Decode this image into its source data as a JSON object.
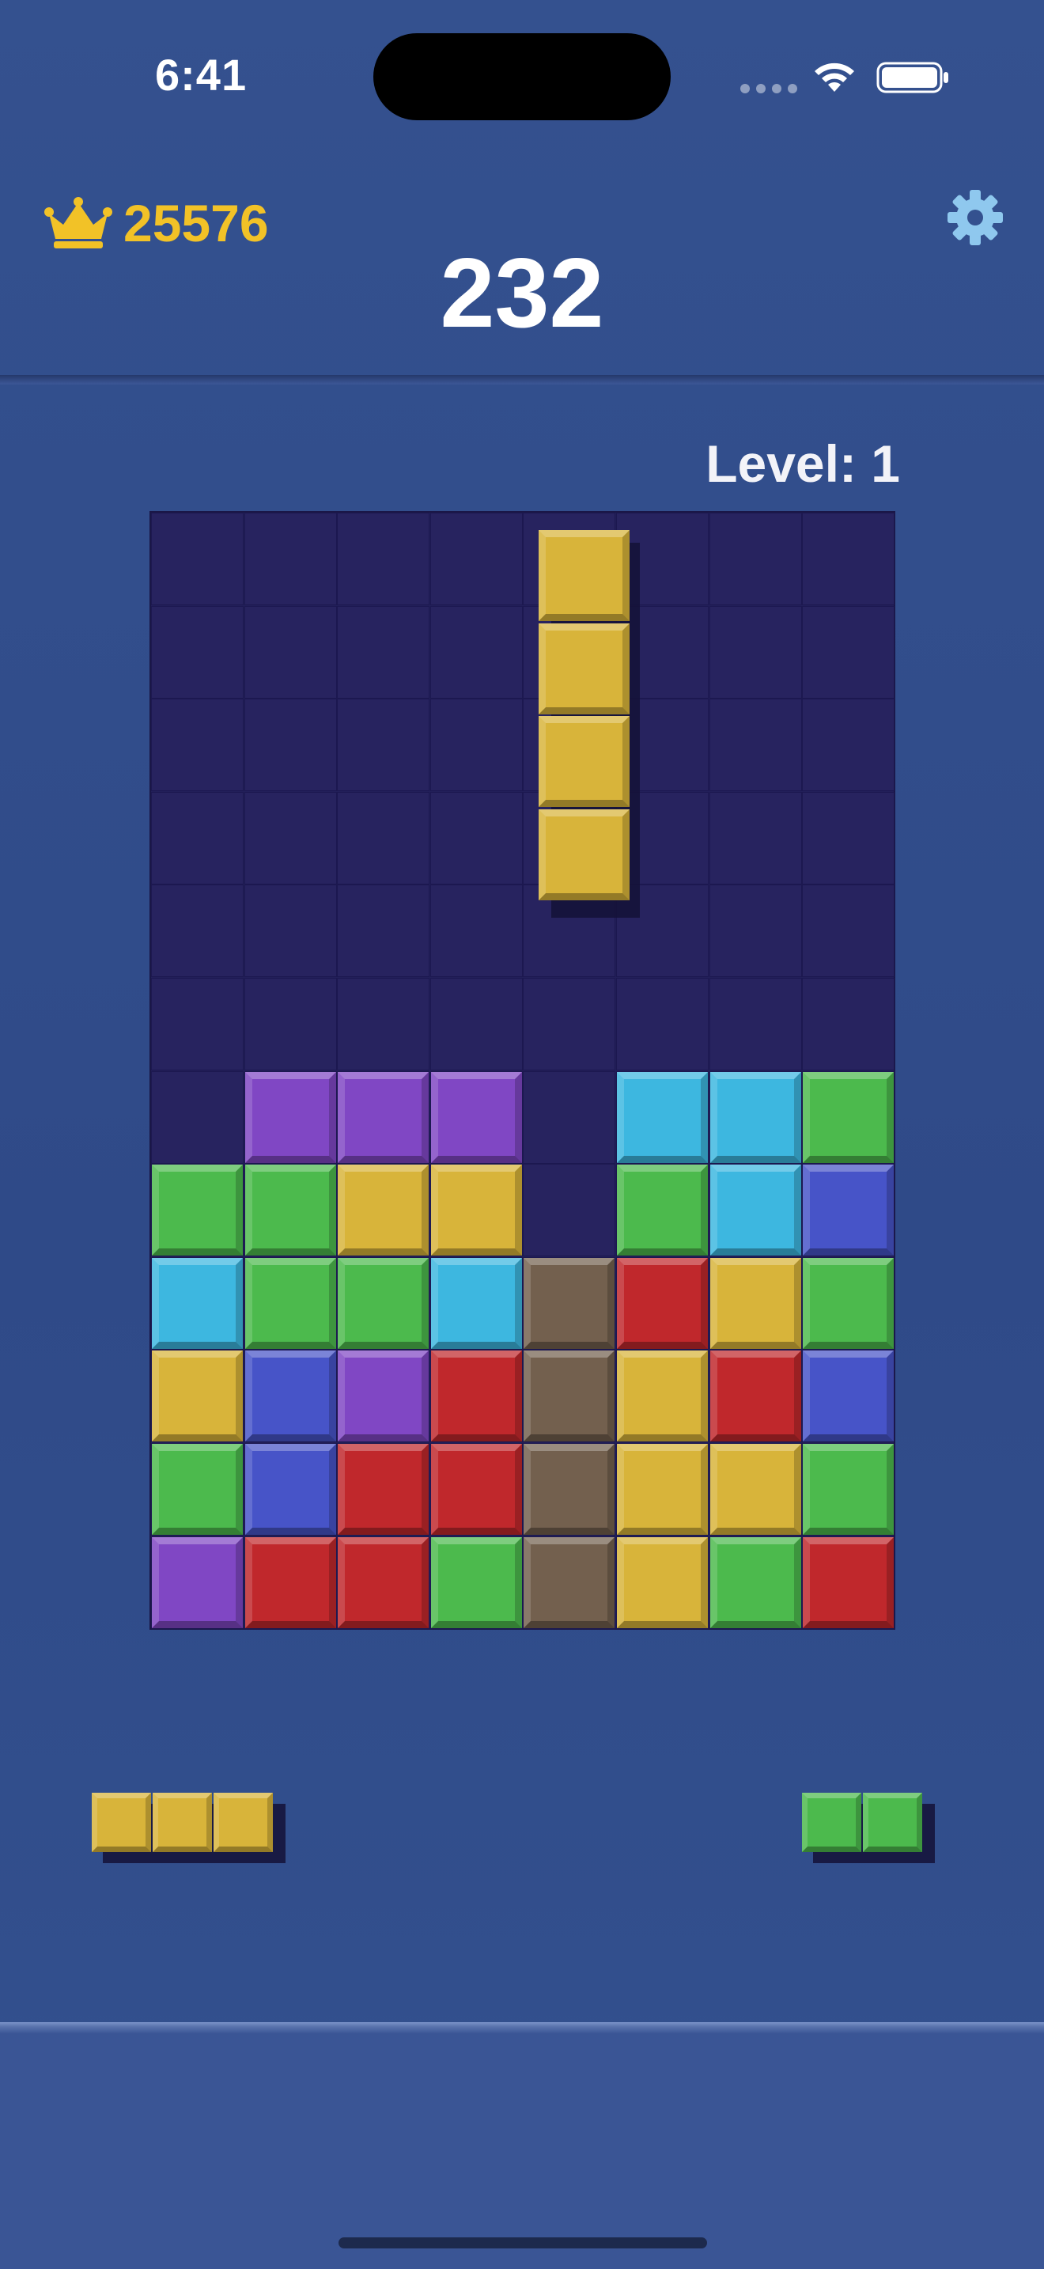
{
  "status_bar": {
    "time": "6:41"
  },
  "header": {
    "best_score": "25576",
    "score": "232",
    "crown_icon": "crown-icon",
    "settings_icon": "gear-icon"
  },
  "level": {
    "label": "Level: 1"
  },
  "colors": {
    "background": "#33508e",
    "board": "#221f59",
    "yellow": "#d8b43a",
    "purple": "#8047c4",
    "cyan": "#3db7e0",
    "green": "#4cba4d",
    "blue": "#4754c8",
    "red": "#c0282c",
    "brown": "#73604e",
    "accent_gold": "#f2c227"
  },
  "board": {
    "columns": 8,
    "rows": 12,
    "falling_piece": {
      "shape": "vertical-I",
      "color": "yellow",
      "column": 4,
      "rows": [
        0,
        1,
        2,
        3
      ]
    },
    "grid": [
      [
        null,
        null,
        null,
        null,
        null,
        null,
        null,
        null
      ],
      [
        null,
        null,
        null,
        null,
        null,
        null,
        null,
        null
      ],
      [
        null,
        null,
        null,
        null,
        null,
        null,
        null,
        null
      ],
      [
        null,
        null,
        null,
        null,
        null,
        null,
        null,
        null
      ],
      [
        null,
        null,
        null,
        null,
        null,
        null,
        null,
        null
      ],
      [
        null,
        null,
        null,
        null,
        null,
        null,
        null,
        null
      ],
      [
        null,
        "purple",
        "purple",
        "purple",
        null,
        "cyan",
        "cyan",
        "green"
      ],
      [
        "green",
        "green",
        "yellow",
        "yellow",
        null,
        "green",
        "cyan",
        "blue"
      ],
      [
        "cyan",
        "green",
        "green",
        "cyan",
        "brown",
        "red",
        "yellow",
        "green"
      ],
      [
        "yellow",
        "blue",
        "purple",
        "red",
        "brown",
        "yellow",
        "red",
        "blue"
      ],
      [
        "green",
        "blue",
        "red",
        "red",
        "brown",
        "yellow",
        "yellow",
        "green"
      ],
      [
        "purple",
        "red",
        "red",
        "green",
        "brown",
        "yellow",
        "green",
        "red"
      ]
    ]
  },
  "next_pieces": [
    {
      "shape": "horizontal-3",
      "color": "yellow",
      "cells": 3
    },
    {
      "shape": "horizontal-2",
      "color": "green",
      "cells": 2
    }
  ]
}
